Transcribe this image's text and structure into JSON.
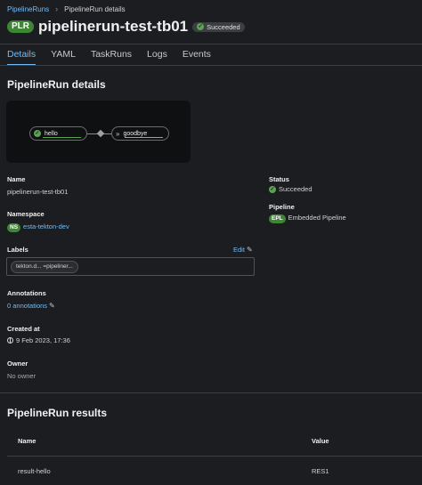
{
  "breadcrumb": {
    "parent": "PipelineRuns",
    "separator": "›",
    "current": "PipelineRun details"
  },
  "header": {
    "badge": "PLR",
    "title": "pipelinerun-test-tb01",
    "status": "Succeeded"
  },
  "tabs": [
    {
      "label": "Details",
      "active": true
    },
    {
      "label": "YAML",
      "active": false
    },
    {
      "label": "TaskRuns",
      "active": false
    },
    {
      "label": "Logs",
      "active": false
    },
    {
      "label": "Events",
      "active": false
    }
  ],
  "details": {
    "heading": "PipelineRun details",
    "graph": {
      "tasks": [
        "hello",
        "goodbye"
      ]
    },
    "name_label": "Name",
    "name_value": "pipelinerun-test-tb01",
    "namespace_label": "Namespace",
    "namespace_badge": "NS",
    "namespace_value": "esta-tekton-dev",
    "labels_label": "Labels",
    "labels_edit": "Edit",
    "labels_chips": [
      "tekton.d... =pipeliner..."
    ],
    "annotations_label": "Annotations",
    "annotations_value": "0 annotations",
    "created_label": "Created at",
    "created_value": "9 Feb 2023, 17:36",
    "owner_label": "Owner",
    "owner_value": "No owner",
    "status_label": "Status",
    "status_value": "Succeeded",
    "pipeline_label": "Pipeline",
    "pipeline_badge": "EPL",
    "pipeline_value": "Embedded Pipeline"
  },
  "results": {
    "heading": "PipelineRun results",
    "columns": [
      "Name",
      "Value"
    ],
    "rows": [
      {
        "name": "result-hello",
        "value": "RES1"
      }
    ]
  },
  "colors": {
    "accent": "#73bcf7",
    "success": "#3e8635",
    "background": "#1b1d21"
  }
}
